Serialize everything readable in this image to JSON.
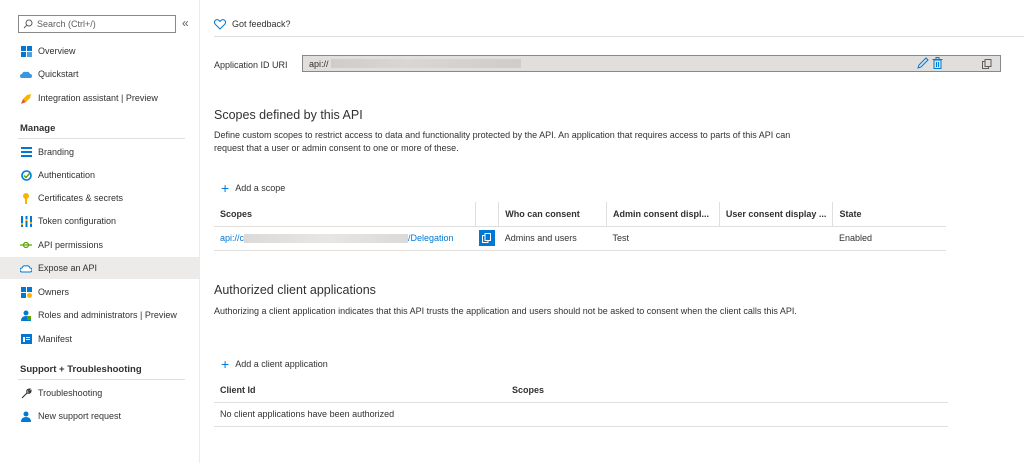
{
  "sidebar": {
    "search_placeholder": "Search (Ctrl+/)",
    "collapse": "«",
    "items": [
      {
        "label": "Overview",
        "icon": "overview-grid-icon"
      },
      {
        "label": "Quickstart",
        "icon": "cloud-quickstart-icon"
      },
      {
        "label": "Integration assistant | Preview",
        "icon": "rocket-icon"
      }
    ],
    "manage_title": "Manage",
    "manage_items": [
      {
        "label": "Branding",
        "icon": "branding-icon"
      },
      {
        "label": "Authentication",
        "icon": "authentication-icon"
      },
      {
        "label": "Certificates & secrets",
        "icon": "key-icon"
      },
      {
        "label": "Token configuration",
        "icon": "token-bars-icon"
      },
      {
        "label": "API permissions",
        "icon": "api-permissions-icon"
      },
      {
        "label": "Expose an API",
        "icon": "cloud-api-icon"
      },
      {
        "label": "Owners",
        "icon": "owners-icon"
      },
      {
        "label": "Roles and administrators | Preview",
        "icon": "roles-icon"
      },
      {
        "label": "Manifest",
        "icon": "manifest-icon"
      }
    ],
    "support_title": "Support + Troubleshooting",
    "support_items": [
      {
        "label": "Troubleshooting",
        "icon": "wrench-icon"
      },
      {
        "label": "New support request",
        "icon": "support-person-icon"
      }
    ]
  },
  "toolbar": {
    "feedback_label": "Got feedback?"
  },
  "app_id_uri": {
    "label": "Application ID URI",
    "value_prefix": "api://"
  },
  "scopes": {
    "title": "Scopes defined by this API",
    "description": "Define custom scopes to restrict access to data and functionality protected by the API. An application that requires access to parts of this API can request that a user or admin consent to one or more of these.",
    "add_label": "Add a scope",
    "columns": [
      "Scopes",
      "",
      "Who can consent",
      "Admin consent displ...",
      "User consent display ...",
      "State"
    ],
    "rows": [
      {
        "scope_prefix": "api://c",
        "scope_suffix": "/Delegation",
        "who": "Admins and users",
        "admin_display": "Test",
        "user_display": "",
        "state": "Enabled"
      }
    ]
  },
  "clients": {
    "title": "Authorized client applications",
    "description": "Authorizing a client application indicates that this API trusts the application and users should not be asked to consent when the client calls this API.",
    "add_label": "Add a client application",
    "columns": [
      "Client Id",
      "Scopes"
    ],
    "empty_message": "No client applications have been authorized"
  },
  "colors": {
    "accent": "#0078d4",
    "active_bg": "#edebe9",
    "border": "#e1dfdd"
  }
}
